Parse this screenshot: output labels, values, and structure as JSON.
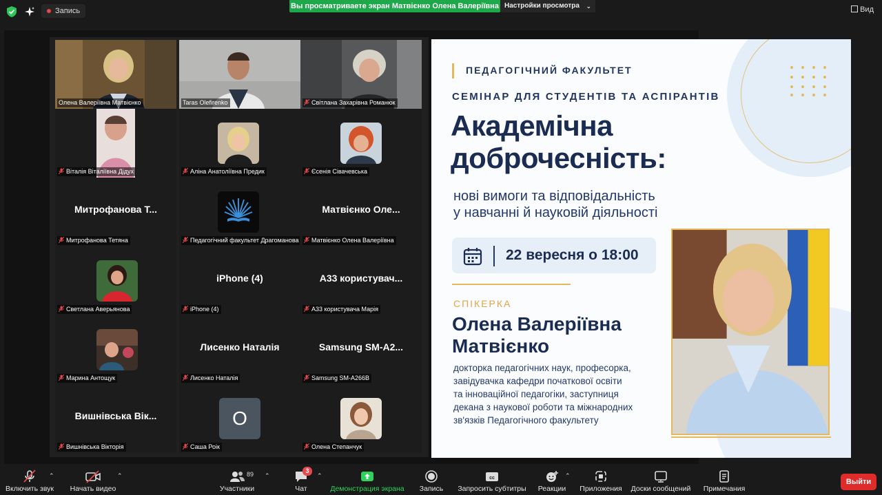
{
  "topbar": {
    "recording_label": "Запись",
    "share_banner": "Вы просматриваете экран Матвієнко Олена Валеріївна",
    "view_settings": "Настройки просмотра",
    "view_label": "Вид"
  },
  "gallery": {
    "tiles": [
      {
        "name": "Олена Валеріївна Матвієнко",
        "big": ""
      },
      {
        "name": "Taras Olefirenko",
        "big": ""
      },
      {
        "name": "Світлана Захарівна Романюк",
        "big": ""
      },
      {
        "name": "Віталія Віталіївна Дідух",
        "big": ""
      },
      {
        "name": "Аліна Анатоліївна Предик",
        "big": ""
      },
      {
        "name": "Єсенія Сівачевська",
        "big": ""
      },
      {
        "name": "Митрофанова Тетяна",
        "big": "Митрофанова  Т..."
      },
      {
        "name": "Педагогічний факультет Драгоманова",
        "big": ""
      },
      {
        "name": "Матвієнко Олена Валеріївна",
        "big": "Матвієнко  Оле..."
      },
      {
        "name": "Светлана Аверьянова",
        "big": ""
      },
      {
        "name": "iPhone (4)",
        "big": "iPhone (4)"
      },
      {
        "name": "A33 користувача Марія",
        "big": "A33  користувач..."
      },
      {
        "name": "Марина Антощук",
        "big": ""
      },
      {
        "name": "Лисенко Наталія",
        "big": "Лисенко Наталія"
      },
      {
        "name": "Samsung SM-A266B",
        "big": "Samsung  SM-A2..."
      },
      {
        "name": "Вишнівська Вікторія",
        "big": "Вишнівська  Вік..."
      },
      {
        "name": "Саша Роік",
        "big": "",
        "letter": "О"
      },
      {
        "name": "Олена Степанчук",
        "big": ""
      }
    ]
  },
  "slide": {
    "faculty": "ПЕДАГОГІЧНИЙ ФАКУЛЬТЕТ",
    "seminar": "СЕМІНАР ДЛЯ СТУДЕНТІВ ТА АСПІРАНТІВ",
    "title_line1": "Академічна",
    "title_line2": "доброчесність:",
    "subtitle_line1": "нові вимоги та відповідальність",
    "subtitle_line2": "у навчанні й науковій діяльності",
    "date": "22 вересня о 18:00",
    "speaker_label": "СПІКЕРКА",
    "speaker_line1": "Олена Валеріївна",
    "speaker_line2": "Матвієнко",
    "bio_line1": "докторка педагогічних наук, професорка,",
    "bio_line2": "завідувачка кафедри початкової освіти",
    "bio_line3": "та інноваційної педагогіки, заступниця",
    "bio_line4": "декана з наукової роботи та міжнародних",
    "bio_line5": "зв'язків Педагогічного факультету"
  },
  "toolbar": {
    "mute": "Включить звук",
    "video": "Начать видео",
    "participants": "Участники",
    "participants_count": "89",
    "chat": "Чат",
    "chat_badge": "3",
    "share": "Демонстрация экрана",
    "record": "Запись",
    "captions": "Запросить субтитры",
    "reactions": "Реакции",
    "apps": "Приложения",
    "boards": "Доски сообщений",
    "notes": "Примечания",
    "leave": "Выйти"
  },
  "colors": {
    "active_speaker": "#3ccf5b",
    "share_banner": "#1ea84a",
    "leave": "#e02b2b",
    "slide_navy": "#1b2c52",
    "slide_gold": "#e5b85c"
  }
}
